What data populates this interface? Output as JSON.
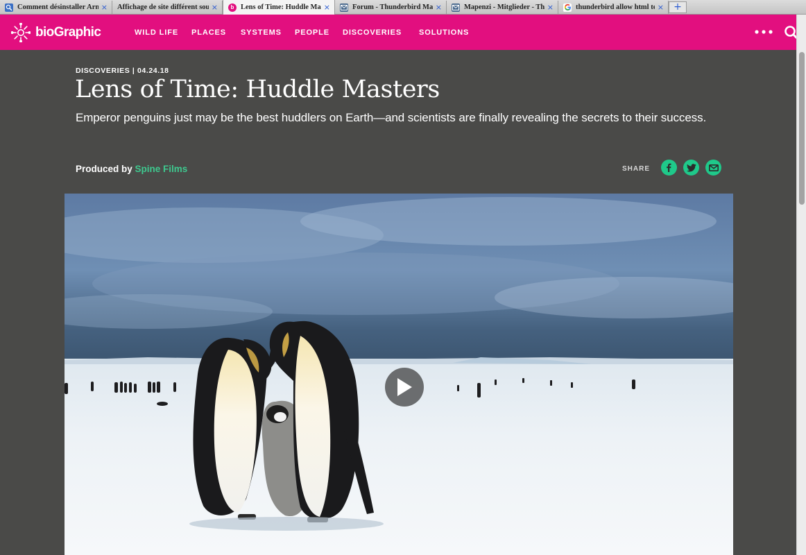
{
  "browser": {
    "tabs": [
      {
        "title": "Comment désinstaller Arn",
        "icon": "search-favicon-icon",
        "active": false
      },
      {
        "title": "Affichage de site différent sous",
        "icon": "",
        "active": false
      },
      {
        "title": "Lens of Time: Huddle Mas",
        "icon": "biographic-favicon-icon",
        "active": true
      },
      {
        "title": "Forum - Thunderbird Mai",
        "icon": "forum-favicon-icon",
        "active": false
      },
      {
        "title": "Mapenzi - Mitglieder - Thu",
        "icon": "forum-favicon-icon",
        "active": false
      },
      {
        "title": "thunderbird allow html tex",
        "icon": "google-favicon-icon",
        "active": false
      }
    ],
    "close_glyph": "×",
    "new_tab_glyph": "+"
  },
  "site": {
    "logo_text": "bioGraphic",
    "nav": [
      "WILD LIFE",
      "PLACES",
      "SYSTEMS",
      "PEOPLE",
      "DISCOVERIES",
      "SOLUTIONS"
    ],
    "brand_color": "#e20f7f",
    "accent_color": "#1fc98a"
  },
  "article": {
    "kicker": "DISCOVERIES | 04.24.18",
    "title": "Lens of Time: Huddle Masters",
    "dek": "Emperor penguins just may be the best huddlers on Earth—and scientists are finally revealing the secrets to their success.",
    "byline_prefix": "Produced by",
    "producer": "Spine Films",
    "share_label": "SHARE",
    "share_icons": [
      "facebook-icon",
      "twitter-icon",
      "email-icon"
    ]
  },
  "video": {
    "subject": "emperor-penguins-with-chick",
    "play_icon": "play-icon"
  }
}
